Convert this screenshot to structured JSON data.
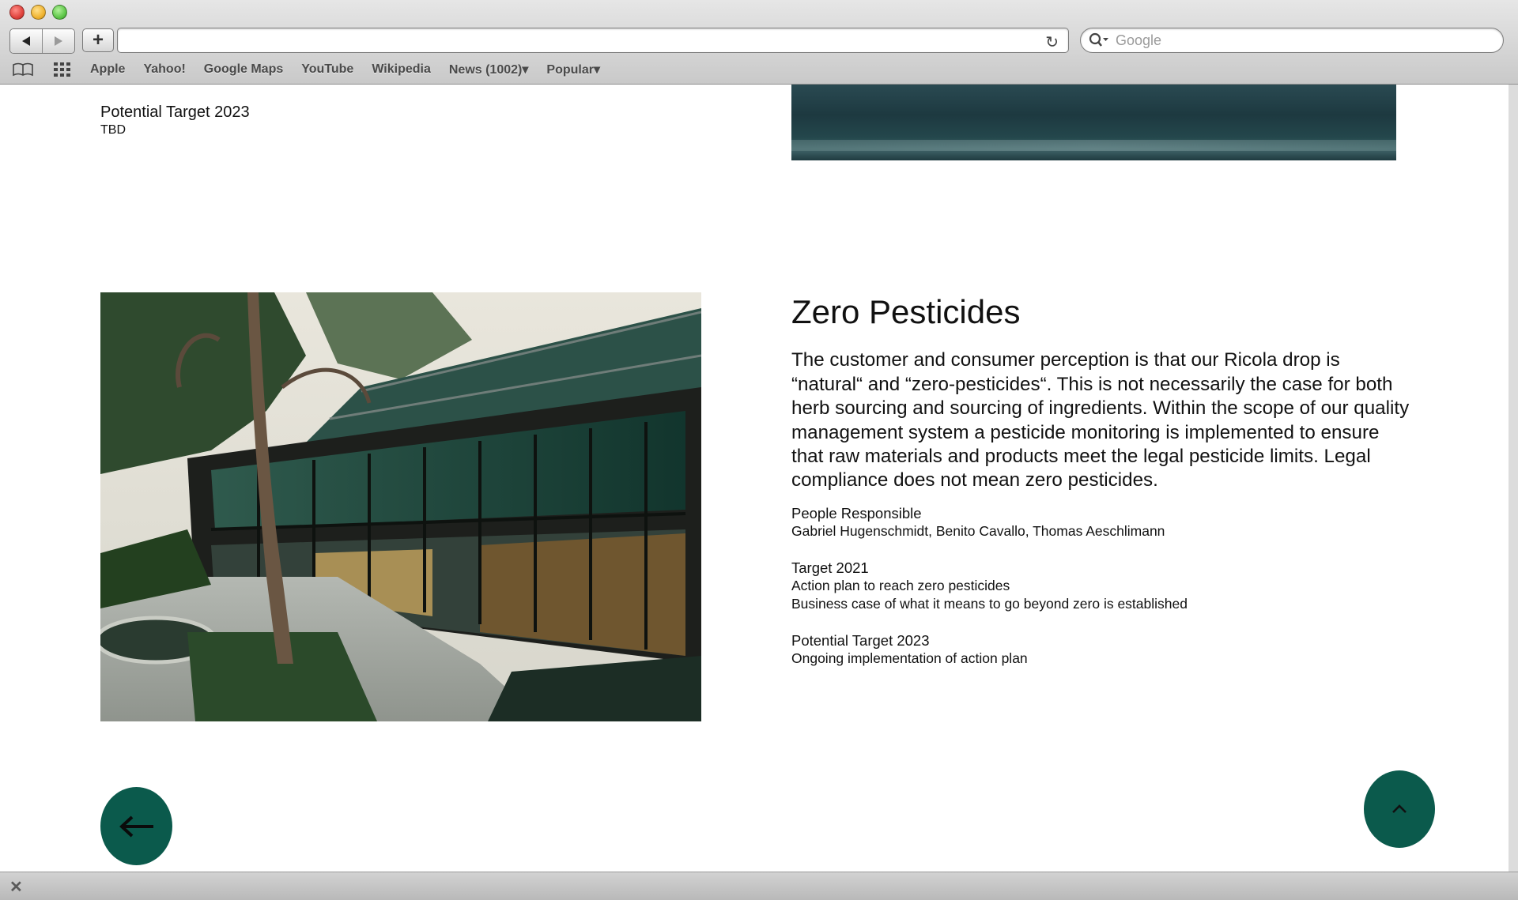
{
  "browser": {
    "search_placeholder": "Google",
    "bookmarks": [
      "Apple",
      "Yahoo!",
      "Google Maps",
      "YouTube",
      "Wikipedia",
      "News (1002)▾",
      "Popular▾"
    ]
  },
  "page": {
    "top_target": {
      "label": "Potential Target 2023",
      "value": "TBD"
    },
    "section": {
      "title": "Zero Pesticides",
      "body": "The customer and consumer perception is that our Ricola drop is “natural“ and “zero-pesticides“. This is not necessarily the case for both herb sourcing and sourcing of ingredients. Within the scope of our quality management system a pesticide monitoring is implemented to ensure that raw materials and products meet the legal pesticide limits. Legal compliance does not mean zero pesticides.",
      "people": {
        "label": "People Responsible",
        "value": "Gabriel Hugenschmidt, Benito Cavallo, Thomas Aeschlimann"
      },
      "target_2021": {
        "label": "Target 2021",
        "lines": [
          "Action plan to reach zero pesticides",
          "Business case of what it means to go beyond zero is established"
        ]
      },
      "target_2023": {
        "label": "Potential Target 2023",
        "value": "Ongoing implementation of action plan"
      }
    }
  },
  "colors": {
    "accent": "#0b5a4c"
  },
  "icons": {
    "back": "arrow-left-icon",
    "top": "chevron-up-icon"
  }
}
